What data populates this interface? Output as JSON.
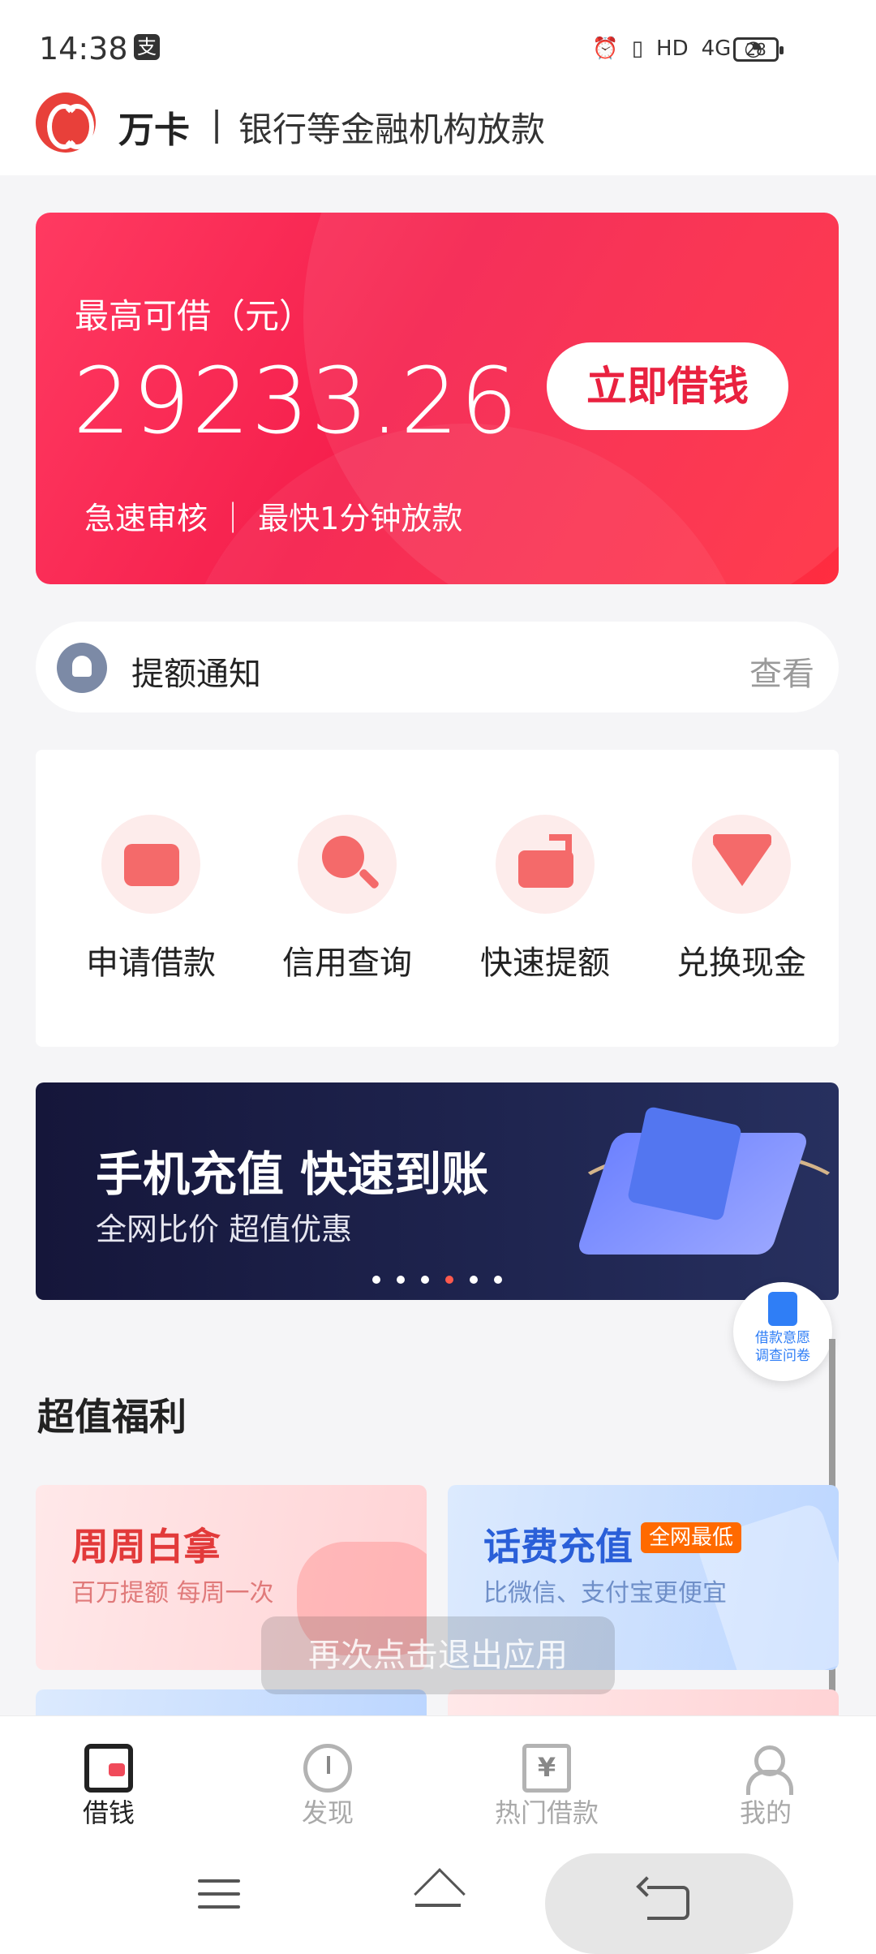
{
  "status_bar": {
    "time": "14:38",
    "carrier_icon": "支",
    "icons": [
      "alarm-icon",
      "vibrate-icon",
      "hd-icon",
      "4g-signal-icon",
      "wifi-icon"
    ],
    "network_label": "HD",
    "net_type": "4G",
    "battery": "28"
  },
  "header": {
    "brand": "万卡",
    "separator": "|",
    "subtitle": "银行等金融机构放款"
  },
  "hero": {
    "label": "最高可借（元）",
    "amount": "29233.26",
    "button_label": "立即借钱",
    "note": "急速审核 ｜ 最快1分钟放款"
  },
  "notice": {
    "title": "提额通知",
    "link": "查看"
  },
  "services": [
    {
      "label": "申请借款",
      "icon": "wallet-icon"
    },
    {
      "label": "信用查询",
      "icon": "search-icon"
    },
    {
      "label": "快速提额",
      "icon": "raise-limit-icon"
    },
    {
      "label": "兑换现金",
      "icon": "diamond-icon"
    }
  ],
  "banner": {
    "title": "手机充值 快速到账",
    "subtitle": "全网比价 超值优惠",
    "dots_total": 6,
    "active_dot": 4
  },
  "survey": {
    "line1": "借款意愿",
    "line2": "调查问卷"
  },
  "section_title": "超值福利",
  "benefits": [
    {
      "title": "周周白拿",
      "subtitle": "百万提额 每周一次"
    },
    {
      "title": "话费充值",
      "badge": "全网最低",
      "subtitle": "比微信、支付宝更便宜"
    }
  ],
  "toast": "再次点击退出应用",
  "tabs": [
    {
      "label": "借钱",
      "active": true,
      "icon": "wallet-tab-icon"
    },
    {
      "label": "发现",
      "active": false,
      "icon": "compass-icon"
    },
    {
      "label": "热门借款",
      "active": false,
      "icon": "yen-icon"
    },
    {
      "label": "我的",
      "active": false,
      "icon": "user-icon"
    }
  ],
  "colors": {
    "brand_red": "#f51f4c",
    "accent_orange": "#ff6a00",
    "blue": "#2a5fd8"
  }
}
